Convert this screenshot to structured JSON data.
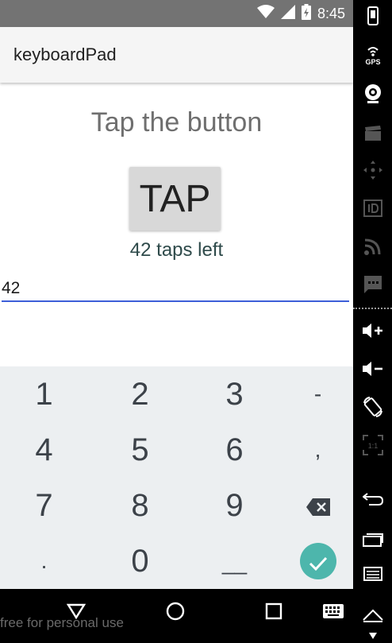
{
  "status_bar": {
    "time": "8:45"
  },
  "app_bar": {
    "title": "keyboardPad"
  },
  "main": {
    "heading": "Tap the button",
    "tap_button_label": "TAP",
    "taps_left_text": "42 taps left",
    "input_value": "42"
  },
  "keyboard": {
    "keys": {
      "k1": "1",
      "k2": "2",
      "k3": "3",
      "dash": "-",
      "k4": "4",
      "k5": "5",
      "k6": "6",
      "comma": ",",
      "k7": "7",
      "k8": "8",
      "k9": "9",
      "period": ".",
      "k0": "0",
      "underscore": "__"
    }
  },
  "watermark": "free for personal use",
  "side_toolbar": {
    "gps_label": "GPS",
    "rotate_label": "1:1"
  },
  "colors": {
    "status_bar": "#737373",
    "input_underline": "#3d5ed8",
    "done_key": "#4db6ac",
    "keyboard_bg": "#eceff1"
  }
}
